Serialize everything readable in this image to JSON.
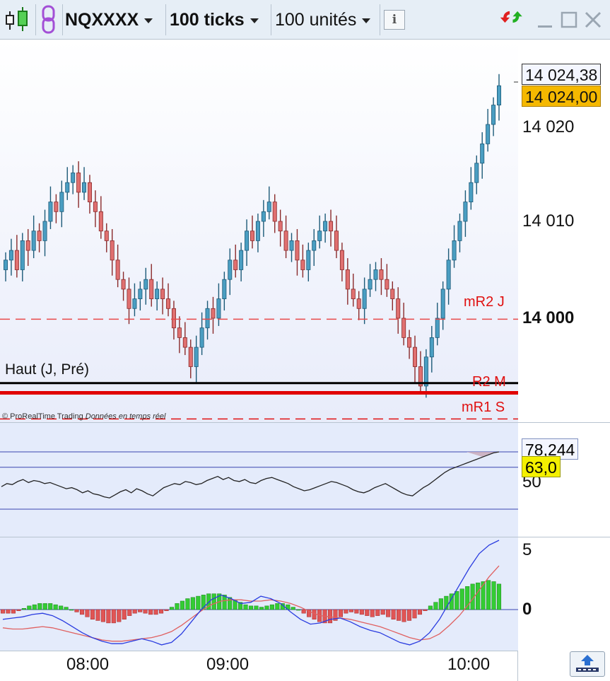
{
  "toolbar": {
    "symbol": "NQXXXX",
    "interval": "100 ticks",
    "units": "100 unités",
    "info_icon_text": "i",
    "icons": [
      "candlestick-chart-icon",
      "link-chain-icon",
      "info-icon",
      "refresh-arrows-icon",
      "minimize-icon",
      "maximize-icon",
      "close-icon"
    ]
  },
  "price_chart": {
    "current_high_box": "14 024,38",
    "current_price_box": "14 024,00",
    "axis_ticks": [
      "14 020",
      "14 010",
      "14 000"
    ],
    "levels": [
      {
        "label": "mR2 J",
        "value": 13999.9,
        "style": "dashed",
        "color": "#e84a4a"
      },
      {
        "label": "Haut (J, Pré)",
        "value": 13993.3,
        "style": "solid",
        "color": "#000000"
      },
      {
        "label": "R2 M",
        "value": 13992.3,
        "style": "solid-thick",
        "color": "#e00000"
      },
      {
        "label": "mR1 S",
        "value": 13989.6,
        "style": "dashed",
        "color": "#e00000"
      }
    ],
    "watermark": "© ProRealTime Trading",
    "watermark_italic": "Données en temps réel",
    "colors": {
      "up": "#4a9ec2",
      "down": "#e07070",
      "outline": "#1c5a78",
      "outline_down": "#8a2a2a"
    }
  },
  "indicator1": {
    "value_box": "78,244",
    "level_box": "63,0",
    "axis_tick": "50",
    "series": [
      44,
      47,
      46,
      49,
      51,
      48,
      50,
      49,
      47,
      48,
      46,
      44,
      42,
      43,
      41,
      38,
      40,
      37,
      36,
      34,
      33,
      36,
      39,
      41,
      38,
      42,
      40,
      37,
      35,
      39,
      43,
      45,
      47,
      46,
      49,
      48,
      46,
      47,
      50,
      52,
      54,
      51,
      53,
      50,
      49,
      51,
      48,
      47,
      50,
      52,
      53,
      51,
      49,
      47,
      44,
      42,
      40,
      41,
      43,
      45,
      47,
      49,
      48,
      46,
      44,
      41,
      39,
      38,
      40,
      43,
      45,
      47,
      44,
      41,
      38,
      36,
      35,
      39,
      43,
      46,
      50,
      54,
      58,
      61,
      63,
      65,
      67,
      69,
      71,
      73,
      75,
      77,
      78
    ],
    "hlines": [
      78,
      63,
      22
    ]
  },
  "indicator2": {
    "axis_ticks": [
      "5",
      "0"
    ],
    "histogram": [
      -0.3,
      -0.3,
      -0.3,
      -0.1,
      0.1,
      0.3,
      0.4,
      0.5,
      0.5,
      0.5,
      0.4,
      0.3,
      0.2,
      0,
      -0.2,
      -0.4,
      -0.6,
      -0.8,
      -0.9,
      -1,
      -1.1,
      -1.1,
      -1,
      -0.8,
      -0.5,
      -0.3,
      -0.2,
      -0.3,
      -0.4,
      -0.4,
      -0.3,
      -0.1,
      0.2,
      0.5,
      0.7,
      0.9,
      1,
      1.1,
      1.2,
      1.3,
      1.3,
      1.3,
      1.2,
      1,
      0.8,
      0.6,
      0.4,
      0.3,
      0.3,
      0.2,
      0.3,
      0.4,
      0.5,
      0.5,
      0.4,
      0.2,
      0,
      -0.3,
      -0.6,
      -0.8,
      -1,
      -1.1,
      -1.1,
      -0.9,
      -0.6,
      -0.3,
      -0.2,
      -0.3,
      -0.4,
      -0.5,
      -0.6,
      -0.5,
      -0.4,
      -0.6,
      -0.8,
      -0.9,
      -1,
      -0.9,
      -0.7,
      -0.4,
      -0.1,
      0.3,
      0.6,
      0.9,
      1.1,
      1.3,
      1.5,
      1.7,
      1.9,
      2.1,
      2.2,
      2.3,
      2.4,
      2.3,
      2.1
    ],
    "macd": [
      -0.8,
      -0.7,
      -0.6,
      -0.4,
      -0.3,
      -0.5,
      -0.9,
      -1.4,
      -1.9,
      -2.3,
      -2.6,
      -2.8,
      -2.8,
      -2.6,
      -2.4,
      -2.6,
      -2.9,
      -2.7,
      -2,
      -1,
      0,
      0.8,
      1.2,
      0.9,
      0.5,
      0.6,
      1.1,
      0.9,
      0.5,
      -0.2,
      -0.8,
      -1.2,
      -1.1,
      -0.8,
      -0.7,
      -1,
      -1.4,
      -1.7,
      -1.9,
      -2.3,
      -2.7,
      -2.9,
      -2.6,
      -1.9,
      -0.8,
      0.6,
      2,
      3.4,
      4.6,
      5.3,
      5.7
    ],
    "signal": [
      -1.5,
      -1.6,
      -1.6,
      -1.5,
      -1.4,
      -1.5,
      -1.7,
      -1.9,
      -2.1,
      -2.3,
      -2.5,
      -2.6,
      -2.6,
      -2.5,
      -2.4,
      -2.3,
      -2.1,
      -1.8,
      -1.3,
      -0.7,
      -0.1,
      0.4,
      0.7,
      0.8,
      0.8,
      0.7,
      0.7,
      0.8,
      0.7,
      0.5,
      0.2,
      -0.2,
      -0.5,
      -0.6,
      -0.7,
      -0.8,
      -1,
      -1.2,
      -1.4,
      -1.7,
      -2,
      -2.3,
      -2.5,
      -2.4,
      -2,
      -1.3,
      -0.5,
      0.5,
      1.6,
      2.7,
      3.6
    ],
    "hist_colors": {
      "pos": "#33cc33",
      "neg": "#e05555"
    },
    "macd_color": "#2a3ce0",
    "signal_color": "#e06060"
  },
  "time_axis": {
    "labels": [
      "08:00",
      "09:00",
      "10:00"
    ]
  }
}
